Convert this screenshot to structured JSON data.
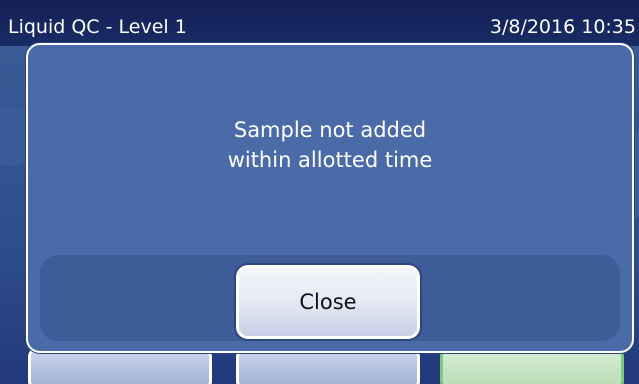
{
  "header": {
    "title": "Liquid QC - Level 1",
    "datetime": "3/8/2016 10:35"
  },
  "dialog": {
    "message_line1": "Sample not added",
    "message_line2": "within allotted time",
    "close_label": "Close"
  }
}
